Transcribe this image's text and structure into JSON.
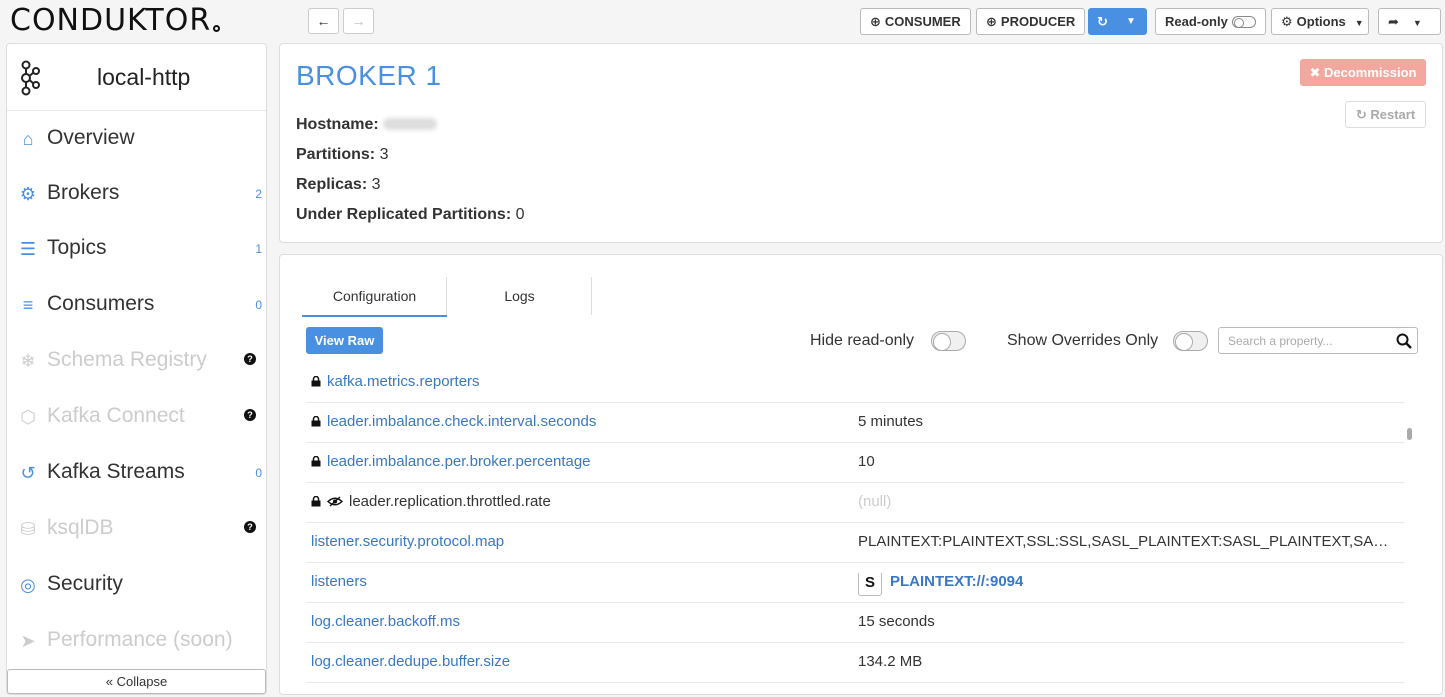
{
  "app": {
    "logo_text": "CONDUKTOR"
  },
  "toolbar": {
    "consumer_label": "CONSUMER",
    "producer_label": "PRODUCER",
    "readonly_label": "Read-only",
    "options_label": "Options"
  },
  "sidebar": {
    "cluster_name": "local-http",
    "items": [
      {
        "label": "Overview",
        "count": "",
        "icon": "home-icon",
        "disabled": false
      },
      {
        "label": "Brokers",
        "count": "2",
        "icon": "cogs-icon",
        "disabled": false
      },
      {
        "label": "Topics",
        "count": "1",
        "icon": "server-icon",
        "disabled": false
      },
      {
        "label": "Consumers",
        "count": "0",
        "icon": "sliders-icon",
        "disabled": false
      },
      {
        "label": "Schema Registry",
        "count": "",
        "icon": "snowflake-icon",
        "disabled": true
      },
      {
        "label": "Kafka Connect",
        "count": "",
        "icon": "hexagon-icon",
        "disabled": true
      },
      {
        "label": "Kafka Streams",
        "count": "0",
        "icon": "streams-icon",
        "disabled": false
      },
      {
        "label": "ksqlDB",
        "count": "",
        "icon": "database-icon",
        "disabled": true
      },
      {
        "label": "Security",
        "count": "",
        "icon": "lock-circle-icon",
        "disabled": false
      },
      {
        "label": "Performance (soon)",
        "count": "",
        "icon": "rocket-icon",
        "disabled": true
      }
    ],
    "collapse_label": "« Collapse"
  },
  "broker": {
    "title": "BROKER 1",
    "hostname_label": "Hostname:",
    "partitions_label": "Partitions:",
    "partitions_value": "3",
    "replicas_label": "Replicas:",
    "replicas_value": "3",
    "urp_label": "Under Replicated Partitions:",
    "urp_value": "0",
    "decommission_label": "Decommission",
    "restart_label": "Restart"
  },
  "config": {
    "tabs": [
      "Configuration",
      "Logs"
    ],
    "view_raw_label": "View Raw",
    "hide_readonly_label": "Hide read-only",
    "show_overrides_label": "Show Overrides Only",
    "search_placeholder": "Search a property...",
    "rows": [
      {
        "key": "kafka.metrics.reporters",
        "value": "",
        "locked": true,
        "eye": false,
        "style": "normal"
      },
      {
        "key": "leader.imbalance.check.interval.seconds",
        "value": "5 minutes",
        "locked": true,
        "eye": false,
        "style": "normal"
      },
      {
        "key": "leader.imbalance.per.broker.percentage",
        "value": "10",
        "locked": true,
        "eye": false,
        "style": "normal"
      },
      {
        "key": "leader.replication.throttled.rate",
        "value": "(null)",
        "locked": true,
        "eye": true,
        "style": "null"
      },
      {
        "key": "listener.security.protocol.map",
        "value": "PLAINTEXT:PLAINTEXT,SSL:SSL,SASL_PLAINTEXT:SASL_PLAINTEXT,SASL_SSL:SASL_SSL",
        "locked": false,
        "eye": false,
        "style": "normal"
      },
      {
        "key": "listeners",
        "value": "PLAINTEXT://:9094",
        "badge": "S",
        "locked": false,
        "eye": false,
        "style": "link"
      },
      {
        "key": "log.cleaner.backoff.ms",
        "value": "15 seconds",
        "locked": false,
        "eye": false,
        "style": "normal"
      },
      {
        "key": "log.cleaner.dedupe.buffer.size",
        "value": "134.2 MB",
        "locked": false,
        "eye": false,
        "style": "normal"
      }
    ]
  },
  "colors": {
    "accent": "#4a90e2",
    "danger_soft": "#f3a89f",
    "link": "#3a78c4"
  }
}
